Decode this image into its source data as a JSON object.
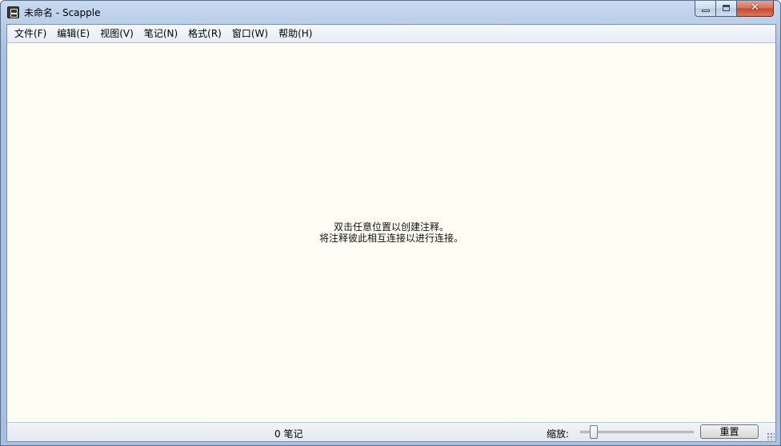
{
  "window": {
    "title": "未命名 - Scapple",
    "close_glyph": "✕"
  },
  "menu": {
    "items": [
      {
        "label": "文件(F)"
      },
      {
        "label": "编辑(E)"
      },
      {
        "label": "视图(V)"
      },
      {
        "label": "笔记(N)"
      },
      {
        "label": "格式(R)"
      },
      {
        "label": "窗口(W)"
      },
      {
        "label": "帮助(H)"
      }
    ]
  },
  "canvas": {
    "hint_line1": "双击任意位置以创建注释。",
    "hint_line2": "将注释彼此相互连接以进行连接。"
  },
  "status": {
    "note_count": "0 笔记",
    "zoom_label": "缩放:",
    "reset_button": "重置"
  },
  "icons": {
    "app": "scapple-app-icon",
    "minimize": "minimize-icon",
    "maximize": "maximize-icon",
    "close": "close-icon"
  },
  "colors": {
    "canvas_background": "#fffef4",
    "title_bar": "#b9cde9",
    "close_button": "#c44a32"
  }
}
